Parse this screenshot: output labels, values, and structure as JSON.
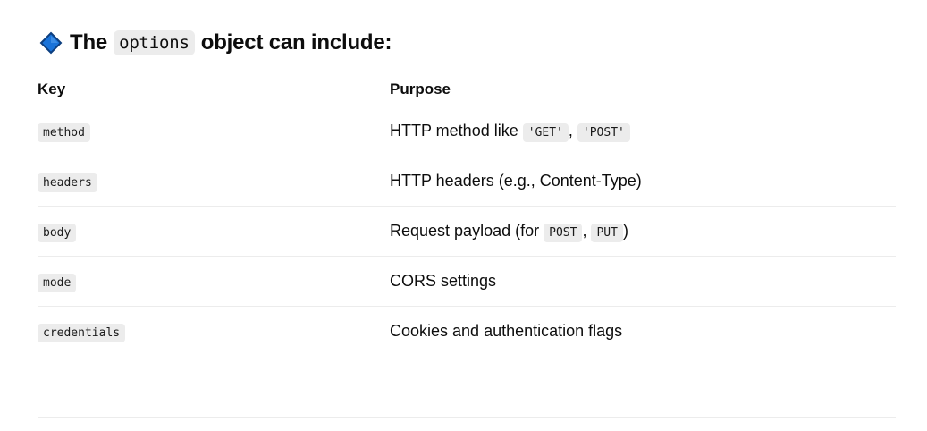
{
  "heading": {
    "prefix": "The",
    "code": "options",
    "suffix": "object can include:",
    "icon": "blue-diamond-icon",
    "icon_color": "#1a73d9"
  },
  "table": {
    "headers": [
      "Key",
      "Purpose"
    ],
    "rows": [
      {
        "key": "method",
        "purpose": "HTTP method like",
        "codes": [
          "'GET'",
          "'POST'"
        ],
        "after": ""
      },
      {
        "key": "headers",
        "purpose": "HTTP headers (e.g., Content-Type)"
      },
      {
        "key": "body",
        "purpose": "Request payload (for",
        "codes": [
          "POST",
          "PUT"
        ],
        "after": ")"
      },
      {
        "key": "mode",
        "purpose": "CORS settings"
      },
      {
        "key": "credentials",
        "purpose": "Cookies and authentication flags"
      }
    ]
  }
}
